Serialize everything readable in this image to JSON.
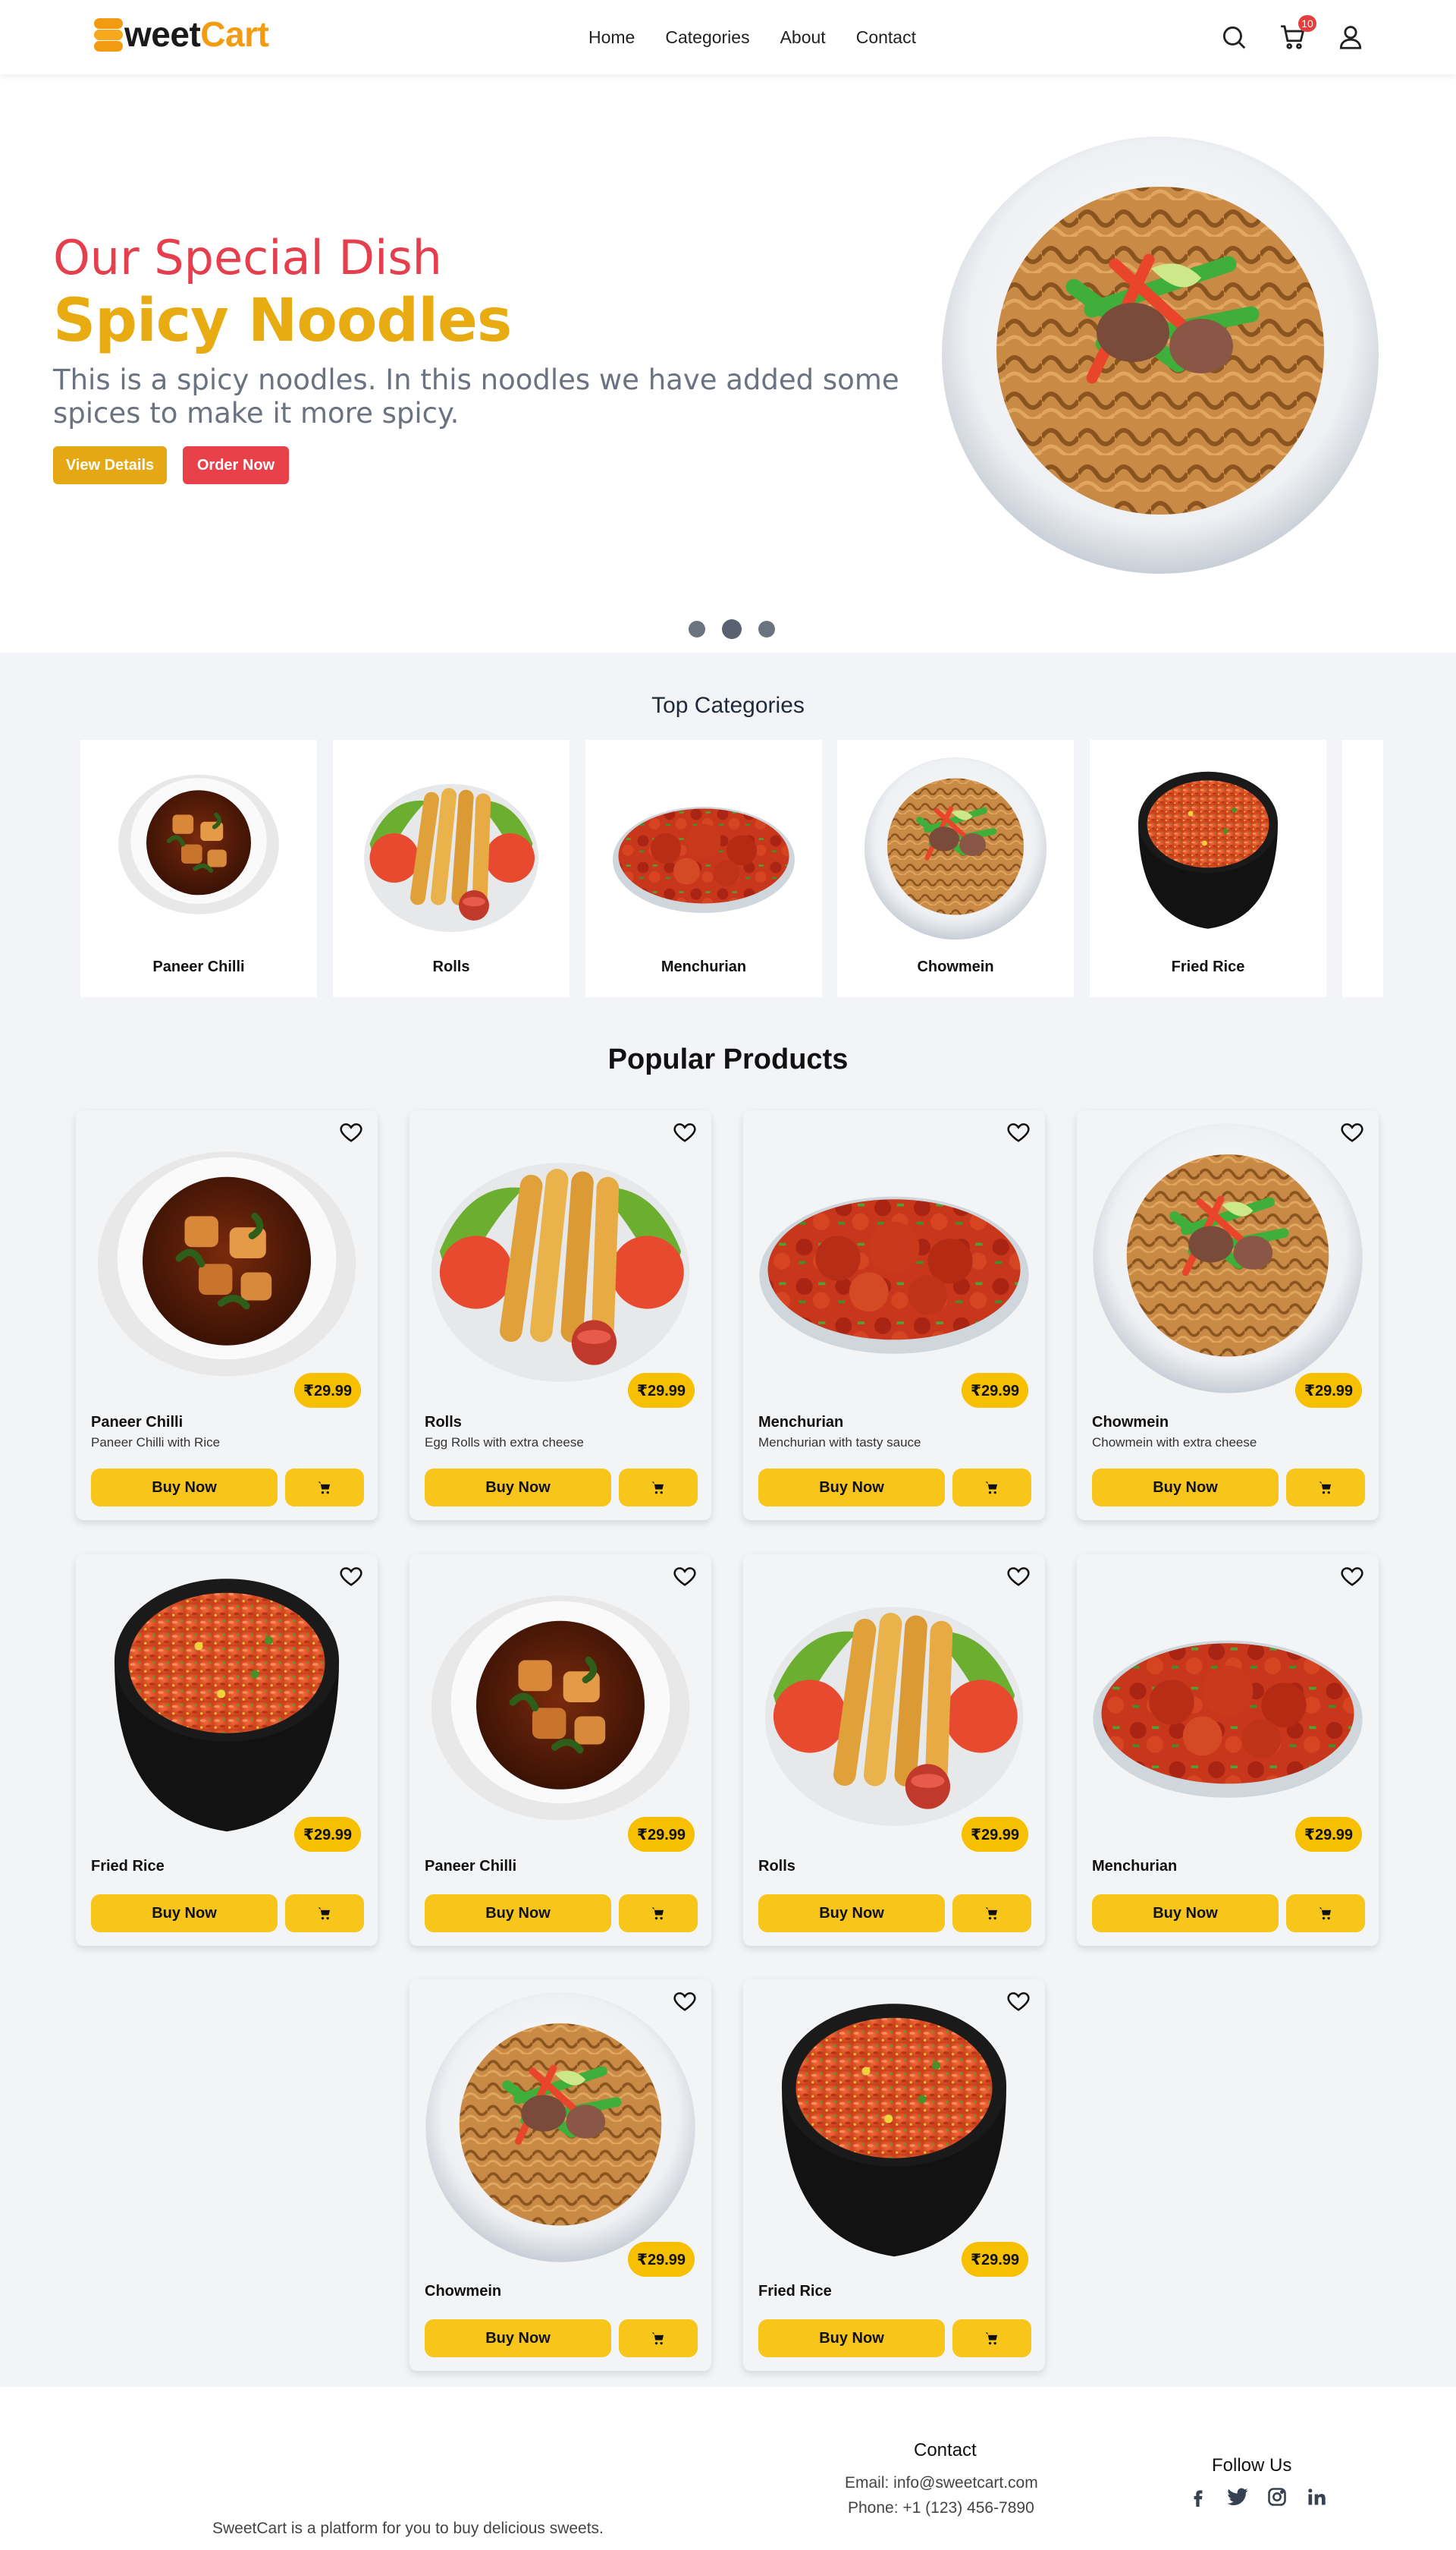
{
  "brand": {
    "logo_first": "S",
    "logo_rest": "weet",
    "logo_cart": "Cart"
  },
  "nav": {
    "links": [
      "Home",
      "Categories",
      "About",
      "Contact"
    ],
    "cart_count": "10"
  },
  "hero": {
    "subtitle": "Our Special Dish",
    "title": "Spicy Noodles",
    "description": "This is a spicy noodles. In this noodles we have added some spices to make it more spicy.",
    "view_label": "View Details",
    "order_label": "Order Now",
    "slide_count": 3,
    "active_slide": 2
  },
  "categories": {
    "title": "Top Categories",
    "items": [
      "Paneer Chilli",
      "Rolls",
      "Menchurian",
      "Chowmein",
      "Fried Rice"
    ]
  },
  "products": {
    "title": "Popular Products",
    "buy_label": "Buy Now",
    "items": [
      {
        "name": "Paneer Chilli",
        "desc": "Paneer Chilli with Rice",
        "price": "₹29.99"
      },
      {
        "name": "Rolls",
        "desc": "Egg Rolls with extra cheese",
        "price": "₹29.99"
      },
      {
        "name": "Menchurian",
        "desc": "Menchurian with tasty sauce",
        "price": "₹29.99"
      },
      {
        "name": "Chowmein",
        "desc": "Chowmein with extra cheese",
        "price": "₹29.99"
      },
      {
        "name": "Fried Rice",
        "desc": "",
        "price": "₹29.99"
      },
      {
        "name": "Paneer Chilli",
        "desc": "",
        "price": "₹29.99"
      },
      {
        "name": "Rolls",
        "desc": "",
        "price": "₹29.99"
      },
      {
        "name": "Menchurian",
        "desc": "",
        "price": "₹29.99"
      },
      {
        "name": "Chowmein",
        "desc": "",
        "price": "₹29.99"
      },
      {
        "name": "Fried Rice",
        "desc": "",
        "price": "₹29.99"
      }
    ]
  },
  "footer": {
    "about": "SweetCart is a platform for you to buy delicious sweets.",
    "contact_title": "Contact",
    "email": "Email: info@sweetcart.com",
    "phone": "Phone: +1 (123) 456-7890",
    "follow_title": "Follow Us",
    "socials": [
      "facebook-icon",
      "twitter-icon",
      "instagram-icon",
      "linkedin-icon"
    ]
  },
  "colors": {
    "accent_yellow": "#f8c51a",
    "accent_red": "#e9414a",
    "title_gold": "#e8ac12"
  }
}
